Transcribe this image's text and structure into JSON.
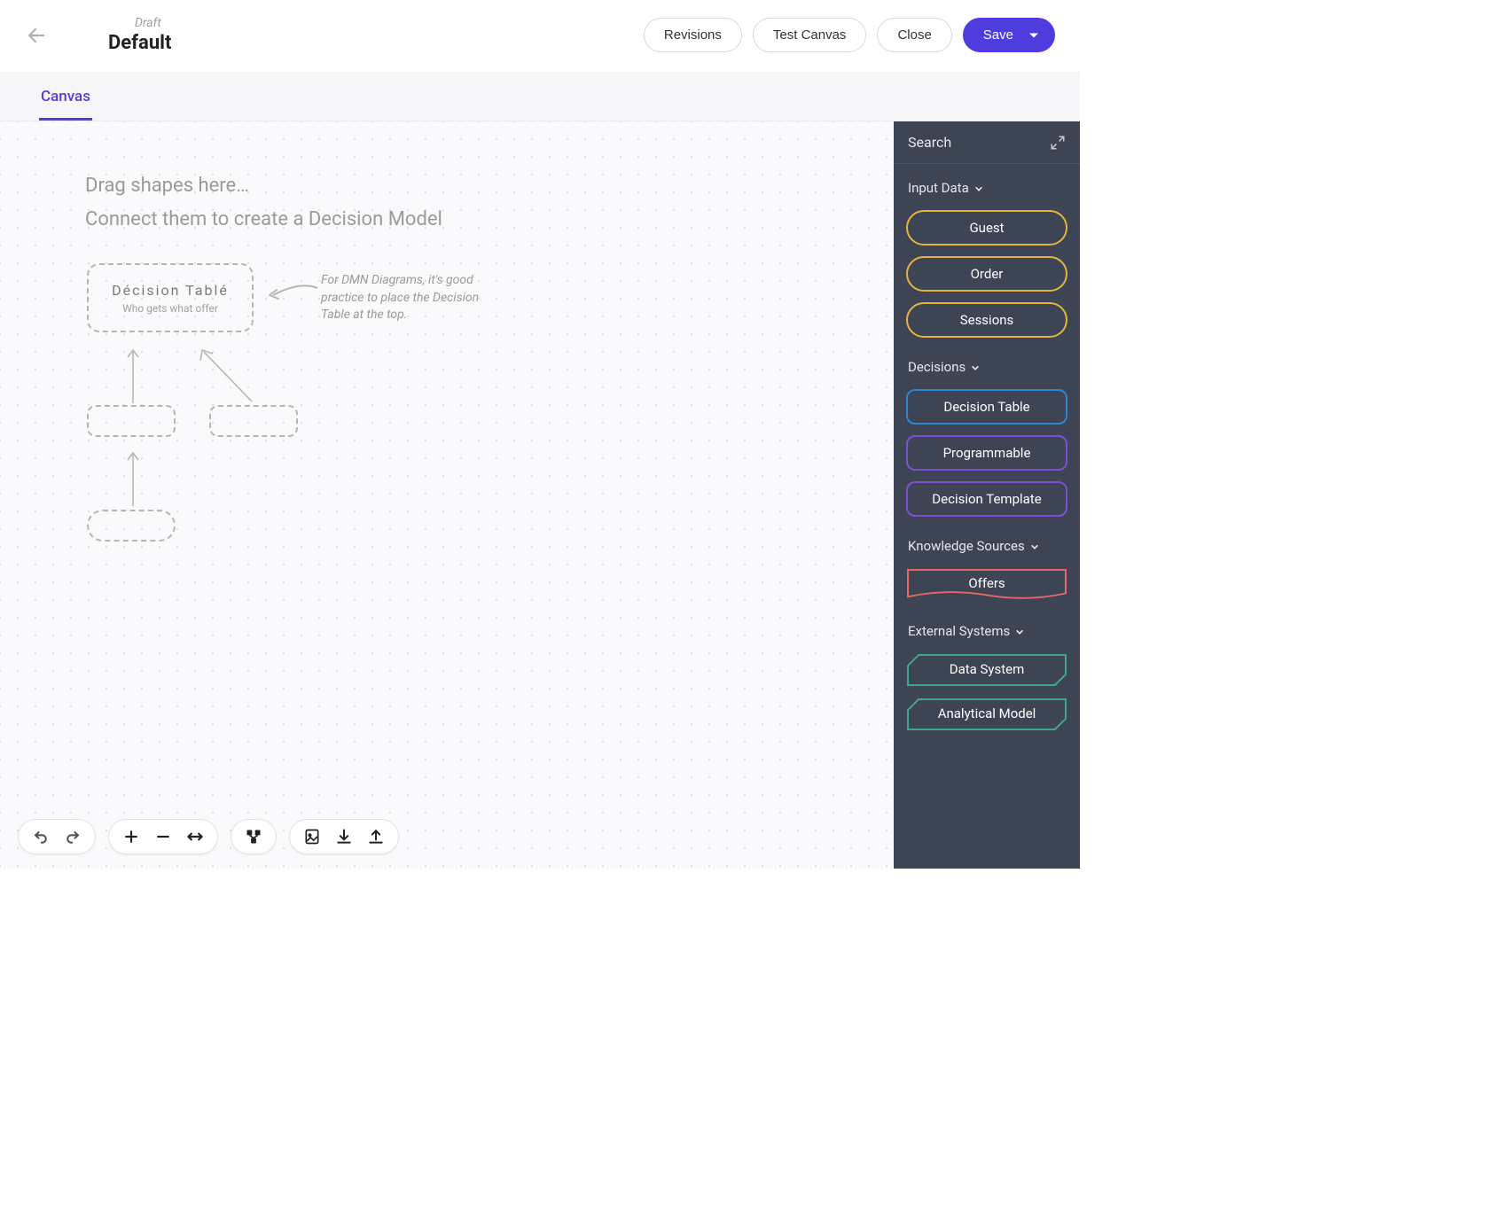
{
  "header": {
    "status_label": "Draft",
    "title": "Default",
    "revisions_label": "Revisions",
    "test_canvas_label": "Test Canvas",
    "close_label": "Close",
    "save_label": "Save"
  },
  "tabs": {
    "canvas_label": "Canvas"
  },
  "canvas": {
    "hint_line1": "Drag shapes here…",
    "hint_line2": "Connect them to create a Decision Model",
    "decision_table_placeholder": {
      "title": "Décision Tablé",
      "subtitle": "Who gets what offer"
    },
    "annotation": "For DMN Diagrams, it's good practice to place the Decision Table at the top."
  },
  "sidebar": {
    "search_label": "Search",
    "sections": {
      "input_data": {
        "title": "Input Data",
        "items": [
          "Guest",
          "Order",
          "Sessions"
        ]
      },
      "decisions": {
        "title": "Decisions",
        "items": [
          "Decision Table",
          "Programmable",
          "Decision Template"
        ]
      },
      "knowledge_sources": {
        "title": "Knowledge Sources",
        "items": [
          "Offers"
        ]
      },
      "external_systems": {
        "title": "External Systems",
        "items": [
          "Data System",
          "Analytical Model"
        ]
      }
    }
  },
  "colors": {
    "primary": "#4f3cde",
    "sidebar_bg": "#3d4454",
    "input_data_border": "#e5b43b",
    "decision_border_blue": "#2d87d0",
    "decision_border_purple": "#7d4fd6",
    "ks_border": "#e46a6a",
    "ext_border": "#3fa68f"
  }
}
